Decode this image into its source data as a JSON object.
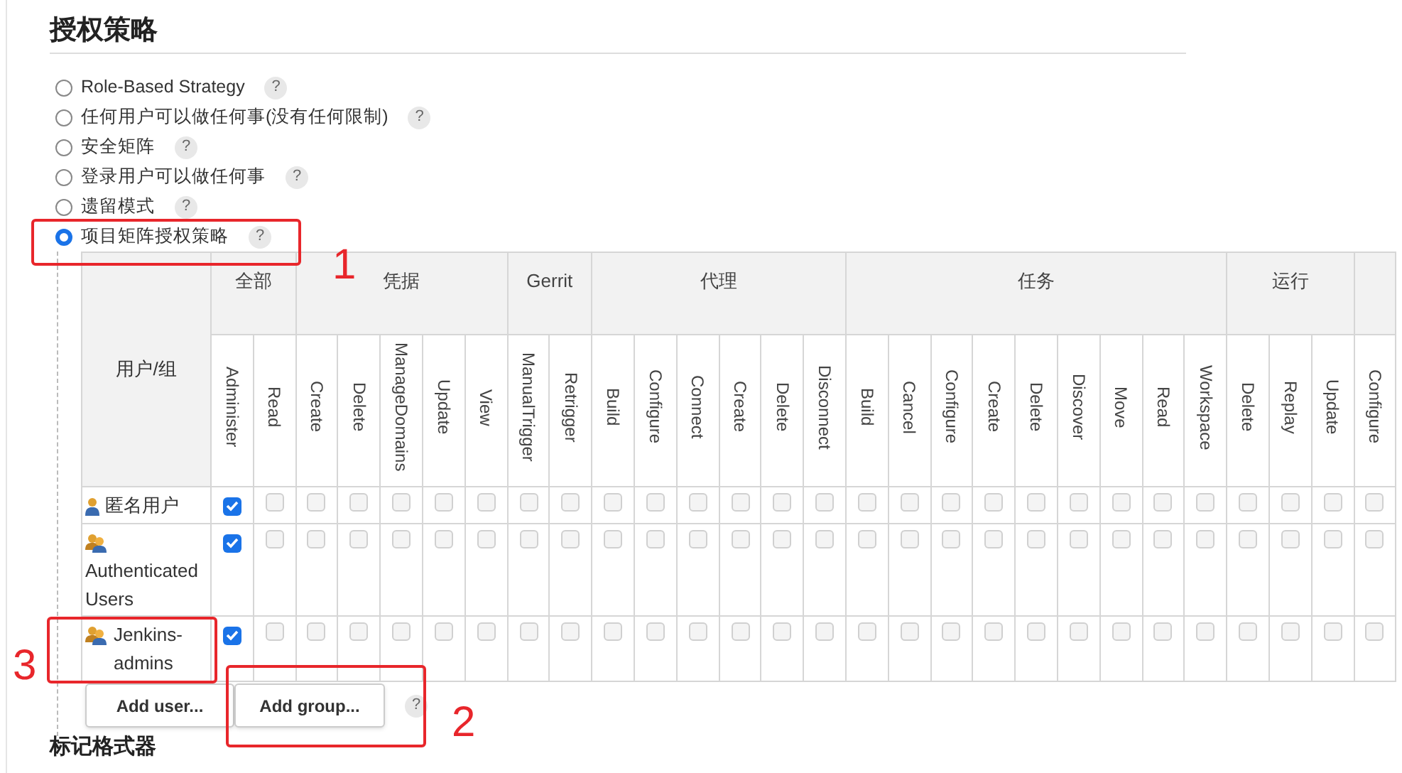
{
  "section_title": "授权策略",
  "strategies": [
    {
      "label": "Role-Based Strategy",
      "selected": false
    },
    {
      "label": "任何用户可以做任何事(没有任何限制)",
      "selected": false
    },
    {
      "label": "安全矩阵",
      "selected": false
    },
    {
      "label": "登录用户可以做任何事",
      "selected": false
    },
    {
      "label": "遗留模式",
      "selected": false
    },
    {
      "label": "项目矩阵授权策略",
      "selected": true
    }
  ],
  "help_label": "?",
  "matrix": {
    "user_column": "用户/组",
    "groups": [
      {
        "label": "全部",
        "permissions": [
          "Administer",
          "Read"
        ]
      },
      {
        "label": "凭据",
        "permissions": [
          "Create",
          "Delete",
          "ManageDomains",
          "Update",
          "View"
        ]
      },
      {
        "label": "Gerrit",
        "permissions": [
          "ManualTrigger",
          "Retrigger"
        ]
      },
      {
        "label": "代理",
        "permissions": [
          "Build",
          "Configure",
          "Connect",
          "Create",
          "Delete",
          "Disconnect"
        ]
      },
      {
        "label": "任务",
        "permissions": [
          "Build",
          "Cancel",
          "Configure",
          "Create",
          "Delete",
          "Discover",
          "Move",
          "Read",
          "Workspace"
        ]
      },
      {
        "label": "运行",
        "permissions": [
          "Delete",
          "Replay",
          "Update"
        ]
      },
      {
        "permissions": [
          "Configure"
        ]
      }
    ],
    "rows": [
      {
        "name": "匿名用户",
        "kind": "user",
        "grants": [
          true,
          false,
          false,
          false,
          false,
          false,
          false,
          false,
          false,
          false,
          false,
          false,
          false,
          false,
          false,
          false,
          false,
          false,
          false,
          false,
          false,
          false,
          false,
          false,
          false,
          false,
          false,
          false
        ]
      },
      {
        "name": "Authenticated Users",
        "kind": "group",
        "grants": [
          true,
          false,
          false,
          false,
          false,
          false,
          false,
          false,
          false,
          false,
          false,
          false,
          false,
          false,
          false,
          false,
          false,
          false,
          false,
          false,
          false,
          false,
          false,
          false,
          false,
          false,
          false,
          false
        ]
      },
      {
        "name": "Jenkins-admins",
        "kind": "group",
        "grants": [
          true,
          false,
          false,
          false,
          false,
          false,
          false,
          false,
          false,
          false,
          false,
          false,
          false,
          false,
          false,
          false,
          false,
          false,
          false,
          false,
          false,
          false,
          false,
          false,
          false,
          false,
          false,
          false
        ]
      }
    ]
  },
  "buttons": [
    "Add user...",
    "Add group..."
  ],
  "next_section_title": "标记格式器",
  "annotations": [
    "1",
    "2",
    "3"
  ]
}
